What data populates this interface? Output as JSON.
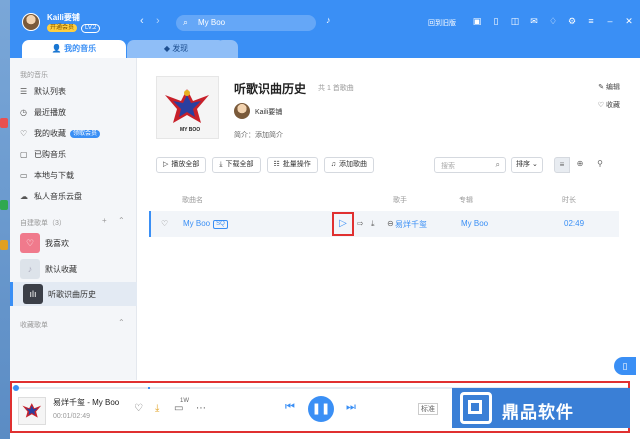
{
  "user": {
    "name": "Kaili要铺",
    "vip": "开通会员",
    "level": "LV.2"
  },
  "nav": {
    "back": "‹",
    "forward": "›"
  },
  "search": {
    "query": "My Boo"
  },
  "topbar": {
    "old_version": "回到旧版"
  },
  "tabs": [
    {
      "label": "我的音乐"
    },
    {
      "label": "发现"
    }
  ],
  "sidebar": {
    "section_my": "我的音乐",
    "items": [
      {
        "label": "默认列表",
        "icon": "list-icon"
      },
      {
        "label": "最近播放",
        "icon": "clock-icon"
      },
      {
        "label": "我的收藏",
        "icon": "heart-icon",
        "badge": "领取会员"
      },
      {
        "label": "已购音乐",
        "icon": "bag-icon"
      },
      {
        "label": "本地与下载",
        "icon": "folder-icon"
      },
      {
        "label": "私人音乐云盘",
        "icon": "cloud-icon"
      }
    ],
    "section_created": "自建歌单（3）",
    "playlists": [
      {
        "label": "我喜欢"
      },
      {
        "label": "默认收藏"
      },
      {
        "label": "听歌识曲历史"
      }
    ],
    "section_collected": "收藏歌单"
  },
  "playlist": {
    "title": "听歌识曲历史",
    "count": "共 1 首歌曲",
    "owner": "Kaili要铺",
    "intro": "简介：添加简介",
    "edit": "编辑",
    "collect": "收藏"
  },
  "toolbar": {
    "play_all": "播放全部",
    "download_all": "下载全部",
    "batch": "批量操作",
    "add_song": "添加歌曲",
    "search_placeholder": "搜索",
    "sort": "排序"
  },
  "columns": {
    "song": "歌曲名",
    "artist": "歌手",
    "album": "专辑",
    "duration": "时长"
  },
  "songs": [
    {
      "title": "My Boo",
      "quality": "SQ",
      "artist": "易烊千玺",
      "album": "My Boo",
      "duration": "02:49"
    }
  ],
  "player": {
    "title": "易烊千玺 - My Boo",
    "time": "00:01/02:49",
    "comments": "1W",
    "quality": "标准"
  },
  "cover_text": "MY BOO",
  "watermark": "鼎品软件",
  "colors": {
    "accent": "#3a8ff5",
    "highlight": "#e03030"
  }
}
